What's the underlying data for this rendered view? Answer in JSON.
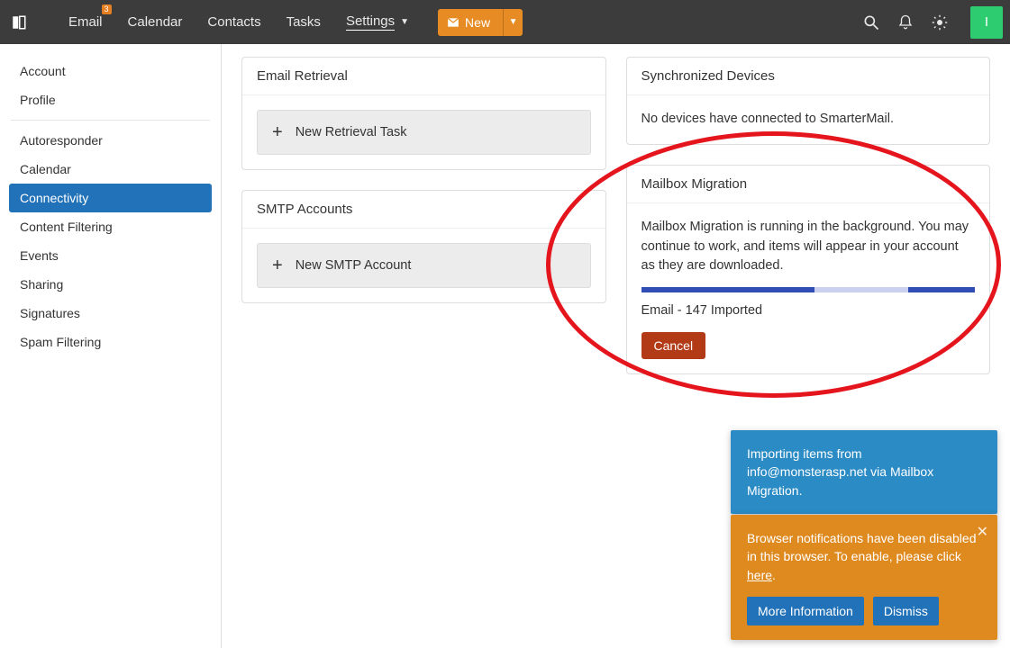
{
  "header": {
    "nav": {
      "email": "Email",
      "email_badge": "3",
      "calendar": "Calendar",
      "contacts": "Contacts",
      "tasks": "Tasks",
      "settings": "Settings"
    },
    "new_button": "New",
    "avatar_letter": "I"
  },
  "sidebar": {
    "items": [
      {
        "label": "Account"
      },
      {
        "label": "Profile"
      },
      {
        "label": "Autoresponder"
      },
      {
        "label": "Calendar"
      },
      {
        "label": "Connectivity"
      },
      {
        "label": "Content Filtering"
      },
      {
        "label": "Events"
      },
      {
        "label": "Sharing"
      },
      {
        "label": "Signatures"
      },
      {
        "label": "Spam Filtering"
      }
    ]
  },
  "cards": {
    "email_retrieval": {
      "title": "Email Retrieval",
      "add_label": "New Retrieval Task"
    },
    "smtp": {
      "title": "SMTP Accounts",
      "add_label": "New SMTP Account"
    },
    "devices": {
      "title": "Synchronized Devices",
      "body": "No devices have connected to SmarterMail."
    },
    "migration": {
      "title": "Mailbox Migration",
      "status_text": "Mailbox Migration is running in the background. You may continue to work, and items will appear in your account as they are downloaded.",
      "progress_label": "Email - 147 Imported",
      "cancel": "Cancel"
    }
  },
  "toasts": {
    "blue": "Importing items from info@monsterasp.net via Mailbox Migration.",
    "orange_text_1": "Browser notifications have been disabled in this browser. To enable, please click ",
    "orange_link": "here",
    "orange_text_2": ".",
    "more_info": "More Information",
    "dismiss": "Dismiss"
  }
}
